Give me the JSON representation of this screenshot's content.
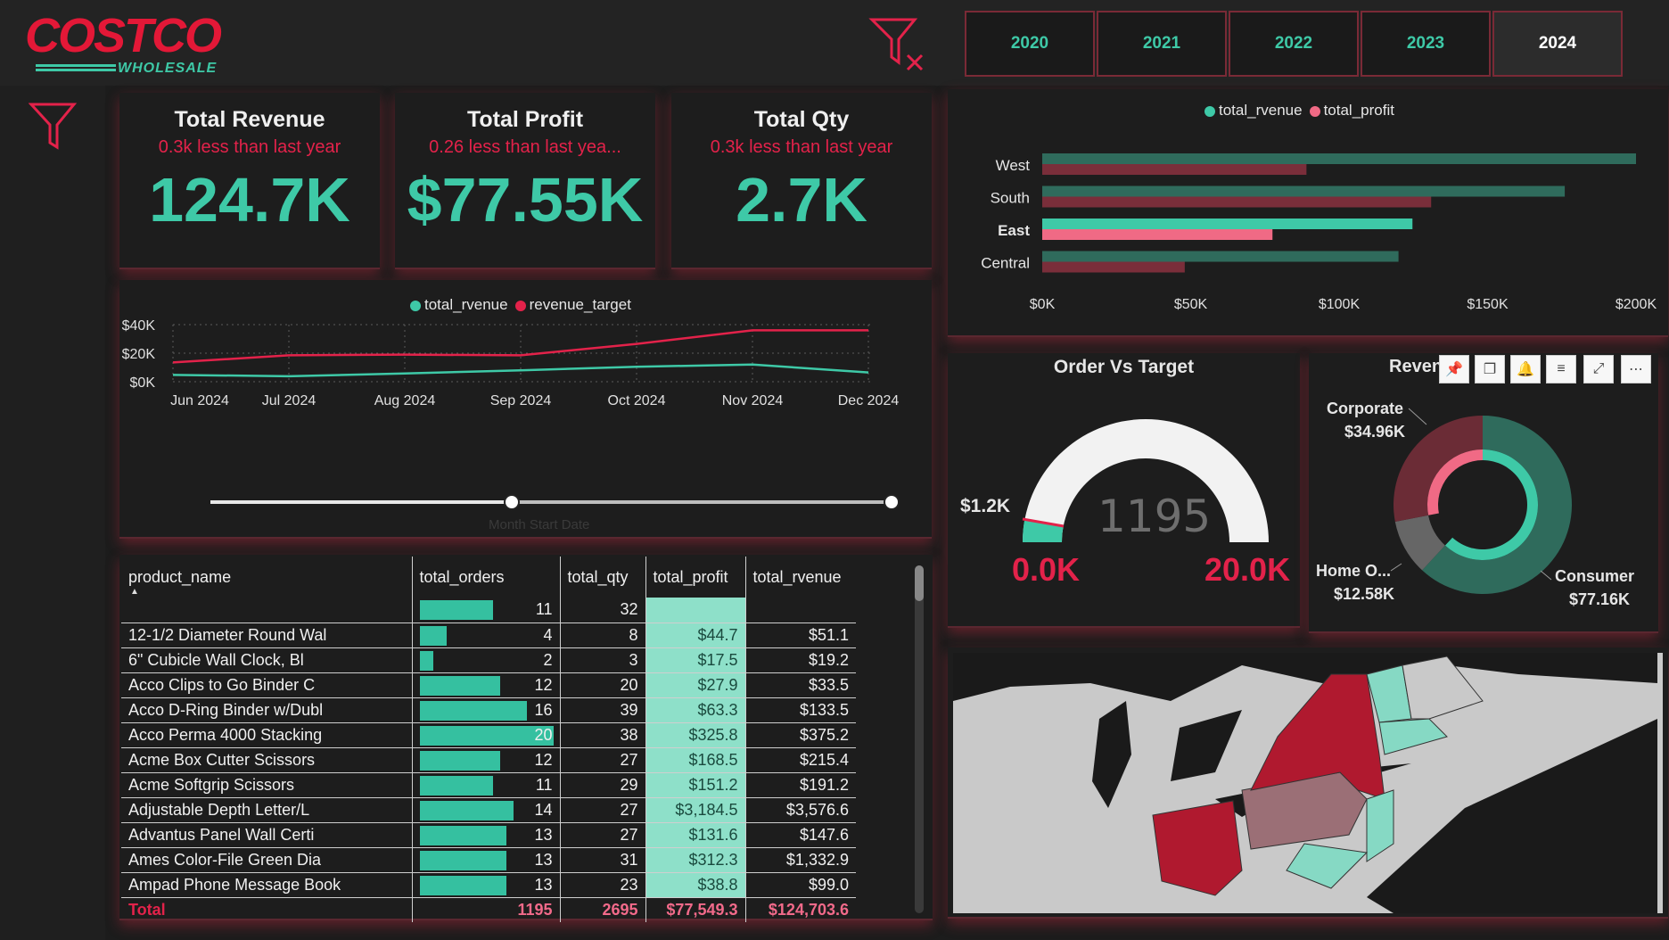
{
  "brand": {
    "name": "COSTCO",
    "sub": "WHOLESALE",
    "color": "#e31837",
    "accent": "#3ec9a7"
  },
  "years": [
    "2020",
    "2021",
    "2022",
    "2023",
    "2024"
  ],
  "selected_year": "2024",
  "kpis": [
    {
      "title": "Total Revenue",
      "sub": "0.3k less than last year",
      "value": "124.7K"
    },
    {
      "title": "Total Profit",
      "sub": "0.26 less than last yea...",
      "value": "$77.55K"
    },
    {
      "title": "Total Qty",
      "sub": "0.3k less than last year",
      "value": "2.7K"
    }
  ],
  "line_chart": {
    "legend": [
      "total_rvenue",
      "revenue_target"
    ],
    "yticks": [
      "$40K",
      "$20K",
      "$0K"
    ],
    "xticks": [
      "Jun 2024",
      "Jul 2024",
      "Aug 2024",
      "Sep 2024",
      "Oct 2024",
      "Nov 2024",
      "Dec 2024"
    ],
    "xlabel": "Month Start Date"
  },
  "bar_chart": {
    "legend": [
      "total_rvenue",
      "total_profit"
    ],
    "categories": [
      "West",
      "South",
      "East",
      "Central"
    ],
    "xticks": [
      "$0K",
      "$50K",
      "$100K",
      "$150K",
      "$200K"
    ]
  },
  "gauge": {
    "title": "Order Vs Target",
    "value": "1195",
    "target_label": "$1.2K",
    "min": "0.0K",
    "max": "20.0K"
  },
  "donut": {
    "title": "Revenue by Segment",
    "title_visible": "Reven",
    "labels": [
      {
        "name": "Corporate",
        "value": "$34.96K"
      },
      {
        "name": "Home O...",
        "value": "$12.58K"
      },
      {
        "name": "Consumer",
        "value": "$77.16K"
      }
    ]
  },
  "table": {
    "columns": [
      "product_name",
      "total_orders",
      "total_qty",
      "total_profit",
      "total_rvenue"
    ],
    "rows": [
      {
        "name": "",
        "orders": "11",
        "qty": "32",
        "profit": "",
        "revenue": ""
      },
      {
        "name": "12-1/2 Diameter Round Wal",
        "orders": "4",
        "qty": "8",
        "profit": "$44.7",
        "revenue": "$51.1"
      },
      {
        "name": "6\" Cubicle Wall Clock, Bl",
        "orders": "2",
        "qty": "3",
        "profit": "$17.5",
        "revenue": "$19.2"
      },
      {
        "name": "Acco Clips to Go Binder C",
        "orders": "12",
        "qty": "20",
        "profit": "$27.9",
        "revenue": "$33.5"
      },
      {
        "name": "Acco D-Ring Binder w/Dubl",
        "orders": "16",
        "qty": "39",
        "profit": "$63.3",
        "revenue": "$133.5"
      },
      {
        "name": "Acco Perma 4000 Stacking",
        "orders": "20",
        "qty": "38",
        "profit": "$325.8",
        "revenue": "$375.2"
      },
      {
        "name": "Acme Box Cutter Scissors",
        "orders": "12",
        "qty": "27",
        "profit": "$168.5",
        "revenue": "$215.4"
      },
      {
        "name": "Acme Softgrip Scissors",
        "orders": "11",
        "qty": "29",
        "profit": "$151.2",
        "revenue": "$191.2"
      },
      {
        "name": "Adjustable Depth Letter/L",
        "orders": "14",
        "qty": "27",
        "profit": "$3,184.5",
        "revenue": "$3,576.6"
      },
      {
        "name": "Advantus Panel Wall Certi",
        "orders": "13",
        "qty": "27",
        "profit": "$131.6",
        "revenue": "$147.6"
      },
      {
        "name": "Ames Color-File Green Dia",
        "orders": "13",
        "qty": "31",
        "profit": "$312.3",
        "revenue": "$1,332.9"
      },
      {
        "name": "Ampad Phone Message Book",
        "orders": "13",
        "qty": "23",
        "profit": "$38.8",
        "revenue": "$99.0"
      }
    ],
    "total": {
      "label": "Total",
      "orders": "1195",
      "qty": "2695",
      "profit": "$77,549.3",
      "revenue": "$124,703.6"
    }
  },
  "chart_data": [
    {
      "type": "line",
      "x": [
        "Jun 2024",
        "Jul 2024",
        "Aug 2024",
        "Sep 2024",
        "Oct 2024",
        "Nov 2024",
        "Dec 2024"
      ],
      "series": [
        {
          "name": "total_rvenue",
          "values": [
            4800,
            3800,
            5800,
            8000,
            10500,
            12000,
            6500
          ],
          "color": "#3ec9a7"
        },
        {
          "name": "revenue_target",
          "values": [
            13500,
            18500,
            19000,
            18500,
            26500,
            36000,
            36000
          ],
          "color": "#e3224a"
        }
      ],
      "ylim": [
        0,
        40000
      ],
      "xlabel": "Month Start Date"
    },
    {
      "type": "bar",
      "orientation": "horizontal",
      "categories": [
        "West",
        "South",
        "East",
        "Central"
      ],
      "series": [
        {
          "name": "total_rvenue",
          "values": [
            200000,
            176000,
            124700,
            120000
          ],
          "color": "#2f6b5c"
        },
        {
          "name": "total_profit",
          "values": [
            89000,
            131000,
            77550,
            48000
          ],
          "color": "#7a2e3a"
        }
      ],
      "highlight": "East",
      "highlight_colors": [
        "#3ec9a7",
        "#f06a85"
      ],
      "xlim": [
        0,
        200000
      ]
    },
    {
      "type": "pie",
      "categories": [
        "Corporate",
        "Home O...",
        "Consumer"
      ],
      "values": [
        34960,
        12580,
        77160
      ],
      "colors": [
        "#6b2c36",
        "#666666",
        "#2f6b5c"
      ],
      "inner_values": [
        34960,
        12580,
        77160
      ],
      "inner_colors": [
        "#f06a85",
        "#1d1d1d",
        "#3ec9a7"
      ]
    }
  ],
  "map": {
    "highlight_colors": [
      "#b0192f",
      "#9b6f76",
      "#86d9c4",
      "#c9c9c9"
    ]
  }
}
